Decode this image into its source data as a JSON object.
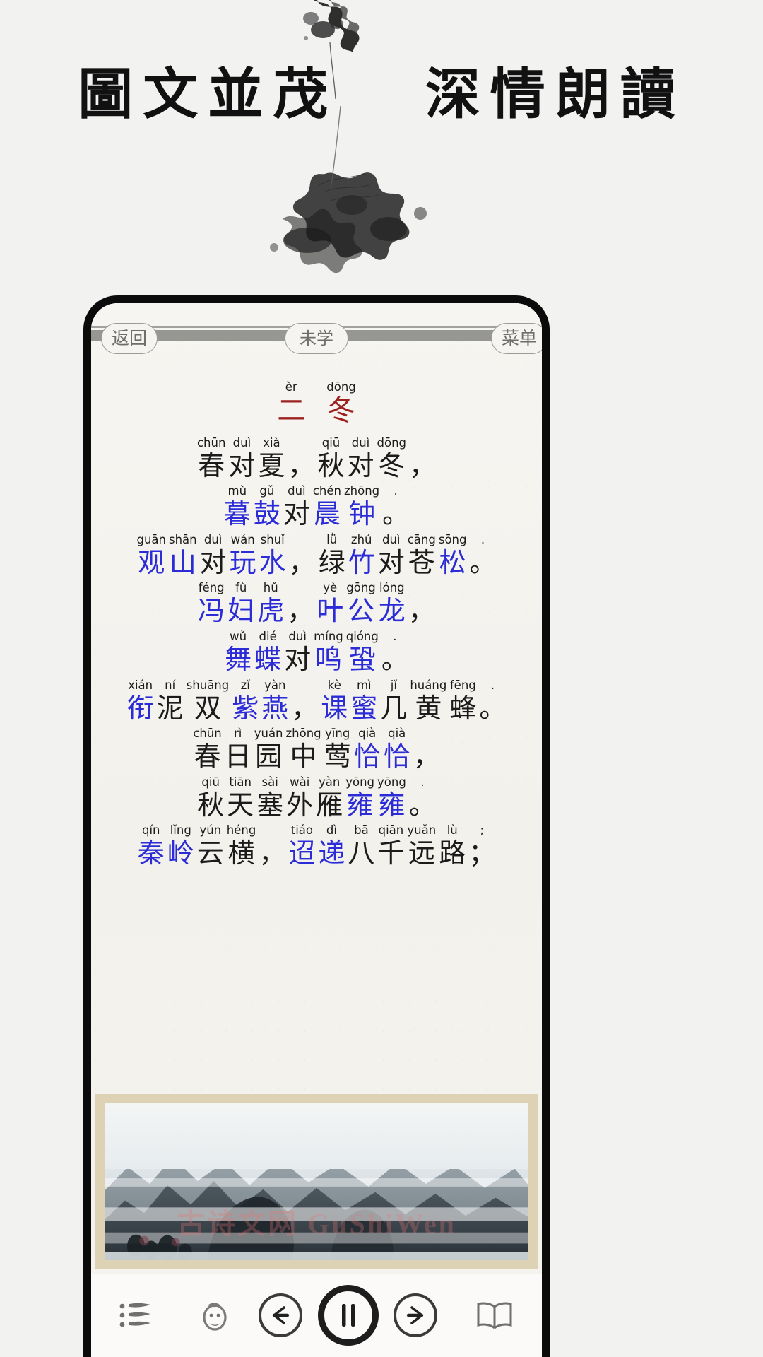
{
  "hero": {
    "title": "圖文並茂   深情朗讀",
    "ink_decoration": "ink-splash"
  },
  "phone": {
    "navbar": {
      "back_label": "返回",
      "status_label": "未学",
      "menu_label": "菜单",
      "pattern": "meander-band"
    },
    "poem": {
      "title": {
        "pinyin": [
          "èr",
          "dōng"
        ],
        "chars": [
          "二",
          "冬"
        ],
        "color": "#9c2220"
      },
      "lines": [
        {
          "indent": false,
          "tokens": [
            {
              "py": "chūn",
              "hz": "春",
              "c": "k"
            },
            {
              "py": "duì",
              "hz": "对",
              "c": "k"
            },
            {
              "py": "xià",
              "hz": "夏",
              "c": "k"
            },
            {
              "py": "",
              "hz": "，",
              "c": "k"
            },
            {
              "py": "qiū",
              "hz": "秋",
              "c": "k"
            },
            {
              "py": "duì",
              "hz": "对",
              "c": "k"
            },
            {
              "py": "dōng",
              "hz": "冬",
              "c": "k"
            },
            {
              "py": "",
              "hz": "，",
              "c": "k"
            }
          ]
        },
        {
          "indent": true,
          "tokens": [
            {
              "py": "mù",
              "hz": "暮",
              "c": "b"
            },
            {
              "py": "gǔ",
              "hz": "鼓",
              "c": "b"
            },
            {
              "py": "duì",
              "hz": "对",
              "c": "k"
            },
            {
              "py": "chén",
              "hz": "晨",
              "c": "b"
            },
            {
              "py": "zhōng",
              "hz": "钟",
              "c": "b"
            },
            {
              "py": ".",
              "hz": "。",
              "c": "k"
            }
          ]
        },
        {
          "indent": false,
          "tokens": [
            {
              "py": "guān",
              "hz": "观",
              "c": "b"
            },
            {
              "py": "shān",
              "hz": "山",
              "c": "b"
            },
            {
              "py": "duì",
              "hz": "对",
              "c": "k"
            },
            {
              "py": "wán",
              "hz": "玩",
              "c": "b"
            },
            {
              "py": "shuǐ",
              "hz": "水",
              "c": "b"
            },
            {
              "py": "",
              "hz": "，",
              "c": "k"
            },
            {
              "py": "lǜ",
              "hz": "绿",
              "c": "k"
            },
            {
              "py": "zhú",
              "hz": "竹",
              "c": "b"
            },
            {
              "py": "duì",
              "hz": "对",
              "c": "k"
            },
            {
              "py": "cāng",
              "hz": "苍",
              "c": "k"
            },
            {
              "py": "sōng",
              "hz": "松",
              "c": "b"
            },
            {
              "py": ".",
              "hz": "。",
              "c": "k"
            }
          ]
        },
        {
          "indent": true,
          "tokens": [
            {
              "py": "féng",
              "hz": "冯",
              "c": "b"
            },
            {
              "py": "fù",
              "hz": "妇",
              "c": "b"
            },
            {
              "py": "hǔ",
              "hz": "虎",
              "c": "b"
            },
            {
              "py": "",
              "hz": "，",
              "c": "k"
            },
            {
              "py": "yè",
              "hz": "叶",
              "c": "b"
            },
            {
              "py": "gōng",
              "hz": "公",
              "c": "b"
            },
            {
              "py": "lóng",
              "hz": "龙",
              "c": "b"
            },
            {
              "py": "",
              "hz": "，",
              "c": "k"
            }
          ]
        },
        {
          "indent": true,
          "tokens": [
            {
              "py": "wǔ",
              "hz": "舞",
              "c": "b"
            },
            {
              "py": "dié",
              "hz": "蝶",
              "c": "b"
            },
            {
              "py": "duì",
              "hz": "对",
              "c": "k"
            },
            {
              "py": "míng",
              "hz": "鸣",
              "c": "b"
            },
            {
              "py": "qióng",
              "hz": "蛩",
              "c": "b"
            },
            {
              "py": ".",
              "hz": "。",
              "c": "k"
            }
          ]
        },
        {
          "indent": false,
          "tokens": [
            {
              "py": "xián",
              "hz": "衔",
              "c": "b"
            },
            {
              "py": "ní",
              "hz": "泥",
              "c": "k"
            },
            {
              "py": "shuāng",
              "hz": "双",
              "c": "k"
            },
            {
              "py": "zǐ",
              "hz": "紫",
              "c": "b"
            },
            {
              "py": "yàn",
              "hz": "燕",
              "c": "b"
            },
            {
              "py": "",
              "hz": "，",
              "c": "k"
            },
            {
              "py": "kè",
              "hz": "课",
              "c": "b"
            },
            {
              "py": "mì",
              "hz": "蜜",
              "c": "b"
            },
            {
              "py": "jǐ",
              "hz": "几",
              "c": "k"
            },
            {
              "py": "huáng",
              "hz": "黄",
              "c": "k"
            },
            {
              "py": "fēng",
              "hz": "蜂",
              "c": "k"
            },
            {
              "py": ".",
              "hz": "。",
              "c": "k"
            }
          ]
        },
        {
          "indent": false,
          "tokens": [
            {
              "py": "chūn",
              "hz": "春",
              "c": "k"
            },
            {
              "py": "rì",
              "hz": "日",
              "c": "k"
            },
            {
              "py": "yuán",
              "hz": "园",
              "c": "k"
            },
            {
              "py": "zhōng",
              "hz": "中",
              "c": "k"
            },
            {
              "py": "yīng",
              "hz": "莺",
              "c": "k"
            },
            {
              "py": "qià",
              "hz": "恰",
              "c": "b"
            },
            {
              "py": "qià",
              "hz": "恰",
              "c": "b"
            },
            {
              "py": "",
              "hz": "，",
              "c": "k"
            }
          ]
        },
        {
          "indent": false,
          "tokens": [
            {
              "py": "qiū",
              "hz": "秋",
              "c": "k"
            },
            {
              "py": "tiān",
              "hz": "天",
              "c": "k"
            },
            {
              "py": "sài",
              "hz": "塞",
              "c": "k"
            },
            {
              "py": "wài",
              "hz": "外",
              "c": "k"
            },
            {
              "py": "yàn",
              "hz": "雁",
              "c": "k"
            },
            {
              "py": "yōng",
              "hz": "雍",
              "c": "b"
            },
            {
              "py": "yōng",
              "hz": "雍",
              "c": "b"
            },
            {
              "py": ".",
              "hz": "。",
              "c": "k"
            }
          ]
        },
        {
          "indent": false,
          "tokens": [
            {
              "py": "qín",
              "hz": "秦",
              "c": "b"
            },
            {
              "py": "lǐng",
              "hz": "岭",
              "c": "b"
            },
            {
              "py": "yún",
              "hz": "云",
              "c": "k"
            },
            {
              "py": "héng",
              "hz": "横",
              "c": "k"
            },
            {
              "py": "",
              "hz": "，",
              "c": "k"
            },
            {
              "py": "tiáo",
              "hz": "迢",
              "c": "b"
            },
            {
              "py": "dì",
              "hz": "递",
              "c": "b"
            },
            {
              "py": "bā",
              "hz": "八",
              "c": "k"
            },
            {
              "py": "qiān",
              "hz": "千",
              "c": "k"
            },
            {
              "py": "yuǎn",
              "hz": "远",
              "c": "k"
            },
            {
              "py": "lù",
              "hz": "路",
              "c": "k"
            },
            {
              "py": ";",
              "hz": "；",
              "c": "k"
            }
          ]
        }
      ]
    },
    "painting": {
      "caption": "",
      "watermark": "古诗文网 GuShiWen"
    },
    "toolbar": {
      "list_icon": "list-icon",
      "face_icon": "face-icon",
      "prev_icon": "arrow-left-icon",
      "play_icon": "pause-icon",
      "next_icon": "arrow-right-icon",
      "book_icon": "book-icon"
    }
  },
  "colors": {
    "blue": "#2b2bd8",
    "red": "#9c2220",
    "ink": "#1b1b1b",
    "page": "#f2f2f0"
  }
}
